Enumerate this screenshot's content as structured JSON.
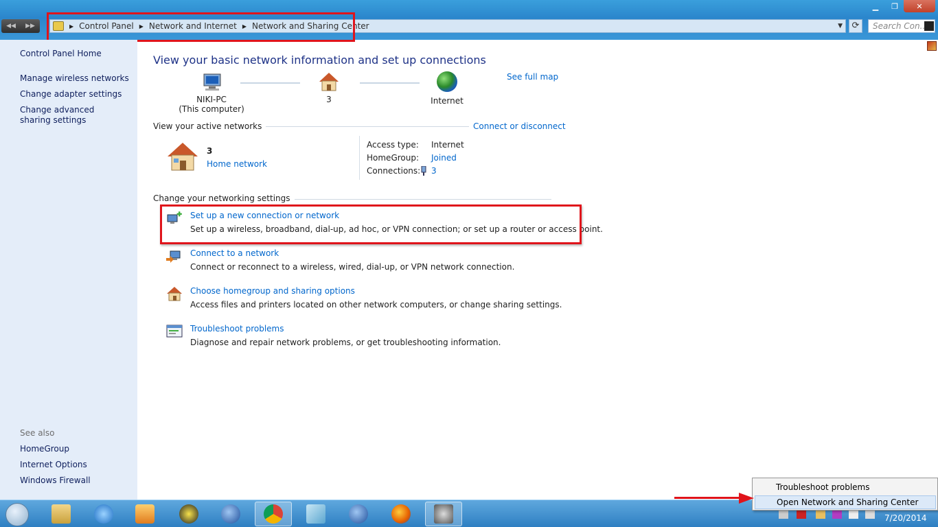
{
  "address": {
    "crumbs": [
      "Control Panel",
      "Network and Internet",
      "Network and Sharing Center"
    ],
    "search_placeholder": "Search Con..."
  },
  "sidebar": {
    "home": "Control Panel Home",
    "links": [
      "Manage wireless networks",
      "Change adapter settings",
      "Change advanced sharing settings"
    ],
    "see_also_label": "See also",
    "see_also": [
      "HomeGroup",
      "Internet Options",
      "Windows Firewall"
    ]
  },
  "main": {
    "title": "View your basic network information and set up connections",
    "see_full_map": "See full map",
    "map": {
      "computer_name": "NIKI-PC",
      "computer_sub": "(This computer)",
      "network": "3",
      "internet": "Internet"
    },
    "active_networks_label": "View your active networks",
    "connect_or_disconnect": "Connect or disconnect",
    "active": {
      "name": "3",
      "type": "Home network",
      "access_type_label": "Access type:",
      "access_type": "Internet",
      "homegroup_label": "HomeGroup:",
      "homegroup": "Joined",
      "connections_label": "Connections:",
      "connections": "3"
    },
    "change_label": "Change your networking settings",
    "tasks": [
      {
        "title": "Set up a new connection or network",
        "desc": "Set up a wireless, broadband, dial-up, ad hoc, or VPN connection; or set up a router or access point."
      },
      {
        "title": "Connect to a network",
        "desc": "Connect or reconnect to a wireless, wired, dial-up, or VPN network connection."
      },
      {
        "title": "Choose homegroup and sharing options",
        "desc": "Access files and printers located on other network computers, or change sharing settings."
      },
      {
        "title": "Troubleshoot problems",
        "desc": "Diagnose and repair network problems, or get troubleshooting information."
      }
    ]
  },
  "context_menu": [
    "Troubleshoot problems",
    "Open Network and Sharing Center"
  ],
  "taskbar": {
    "clock_date": "7/20/2014",
    "apps": [
      "explorer-icon",
      "ie-icon",
      "media-player-icon",
      "vlc-like-icon",
      "app-c-icon",
      "chrome-icon",
      "notepad-icon",
      "app-c2-icon",
      "firefox-icon",
      "settings-app-icon"
    ]
  },
  "colors": {
    "link": "#0066cc",
    "highlight_red": "#e0141b",
    "title": "#1e3287"
  }
}
